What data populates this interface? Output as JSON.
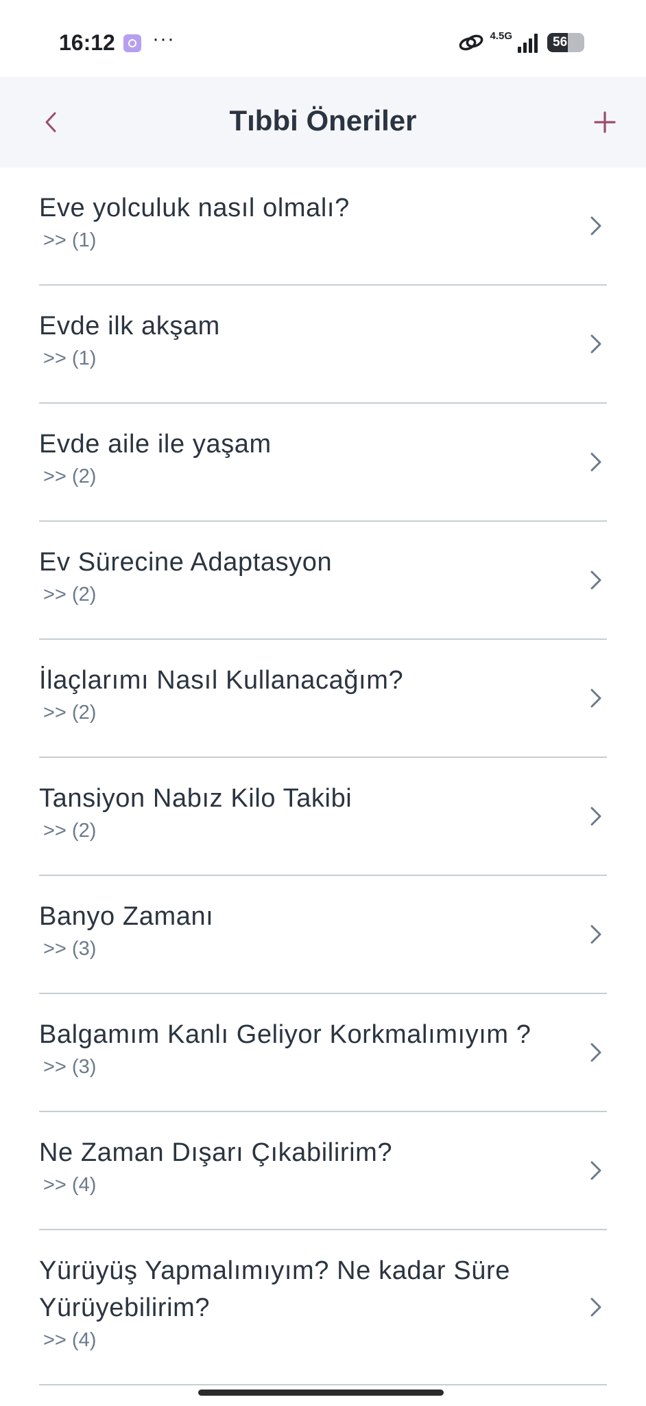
{
  "status_bar": {
    "time": "16:12",
    "more": "···",
    "network": "4.5G",
    "battery": "56",
    "battery_level": 0.56
  },
  "header": {
    "title": "Tıbbi Öneriler",
    "accent_color": "#9b4d6a"
  },
  "items": [
    {
      "title": "Eve yolculuk nasıl olmalı?",
      "sub": ">> (1)"
    },
    {
      "title": "Evde ilk akşam",
      "sub": ">> (1)"
    },
    {
      "title": "Evde aile ile yaşam",
      "sub": ">> (2)"
    },
    {
      "title": "Ev Sürecine Adaptasyon",
      "sub": ">> (2)"
    },
    {
      "title": "İlaçlarımı Nasıl Kullanacağım?",
      "sub": ">> (2)"
    },
    {
      "title": "Tansiyon Nabız Kilo Takibi",
      "sub": ">> (2)"
    },
    {
      "title": "Banyo Zamanı",
      "sub": ">> (3)"
    },
    {
      "title": "Balgamım Kanlı Geliyor Korkmalımıyım ?",
      "sub": ">> (3)"
    },
    {
      "title": "Ne Zaman Dışarı Çıkabilirim?",
      "sub": ">> (4)"
    },
    {
      "title": "Yürüyüş Yapmalımıyım? Ne kadar Süre Yürüyebilirim?",
      "sub": ">> (4)"
    }
  ]
}
